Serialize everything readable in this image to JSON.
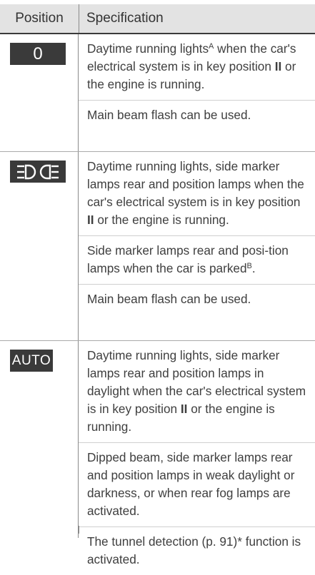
{
  "header": {
    "position_label": "Position",
    "specification_label": "Specification"
  },
  "icons": {
    "row1": "switch-position-0",
    "row2": "position-lamps-icon",
    "row3": "switch-position-auto"
  },
  "rows": [
    {
      "symbol": "0",
      "paragraphs": [
        {
          "before": "Daytime running lights",
          "sup": "A",
          "mid": " when the car's electrical system is in key position ",
          "bold": "II",
          "after": " or the engine is running."
        },
        {
          "text": "Main beam flash can be used."
        }
      ]
    },
    {
      "paragraphs": [
        {
          "before": "Daytime running lights, side marker lamps rear and position lamps when the car's electrical system is in key position ",
          "bold": "II",
          "after": " or the engine is running."
        },
        {
          "before": "Side marker lamps rear and posi-tion lamps when the car is parked",
          "sup": "B",
          "after": "."
        },
        {
          "text": "Main beam flash can be used."
        }
      ]
    },
    {
      "symbol": "AUTO",
      "paragraphs": [
        {
          "before": "Daytime running lights, side marker lamps rear and position lamps in daylight when the car's electrical system is in key position ",
          "bold": "II",
          "after": " or the engine is running."
        },
        {
          "text": "Dipped beam, side marker lamps rear and position lamps in weak daylight or darkness, or when rear fog lamps are activated."
        },
        {
          "before": "The tunnel detection (",
          "link": "p. 91",
          "after": ")* function is activated."
        }
      ]
    }
  ]
}
